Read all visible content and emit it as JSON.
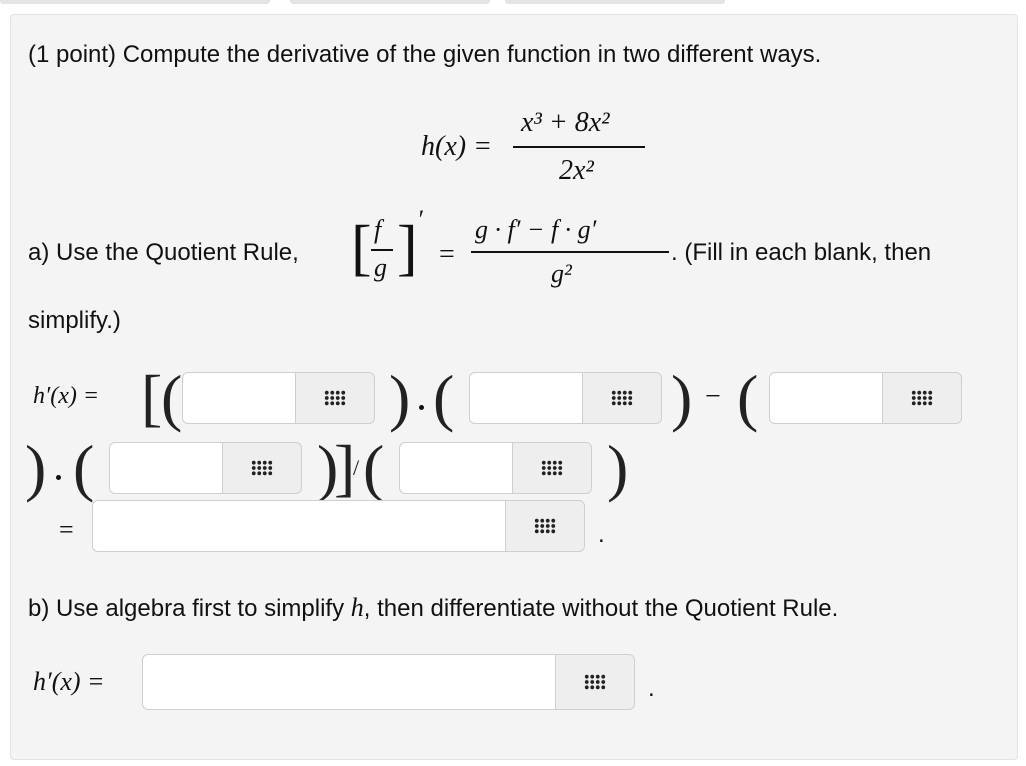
{
  "problem": {
    "points_label": "(1 point)",
    "statement": "Compute the derivative of the given function in two different ways."
  },
  "function_display": {
    "lhs": "h(x) =",
    "numerator": "x³ + 8x²",
    "denominator": "2x²"
  },
  "part_a": {
    "prefix": "a) Use the Quotient Rule,",
    "rule_fraction_top": "f",
    "rule_fraction_bottom": "g",
    "rule_prime": "′",
    "rule_equals": "=",
    "rule_numerator": "g · f′ − f · g′",
    "rule_denominator": "g²",
    "suffix": ". (Fill in each blank, then",
    "suffix_line2": "simplify.)",
    "hprime_label": "h′(x) =",
    "equals": "=",
    "period": ".",
    "blanks": [
      {
        "value": "",
        "placeholder": ""
      },
      {
        "value": "",
        "placeholder": ""
      },
      {
        "value": "",
        "placeholder": ""
      },
      {
        "value": "",
        "placeholder": ""
      },
      {
        "value": "",
        "placeholder": ""
      },
      {
        "value": "",
        "placeholder": ""
      }
    ]
  },
  "part_b": {
    "prefix": "b) Use algebra first to simplify",
    "var": "h",
    "suffix": ", then differentiate without the Quotient Rule.",
    "hprime_label": "h′(x) =",
    "period": ".",
    "blank": {
      "value": "",
      "placeholder": ""
    }
  },
  "icons": {
    "palette_button": "equation-editor-grid-icon"
  }
}
